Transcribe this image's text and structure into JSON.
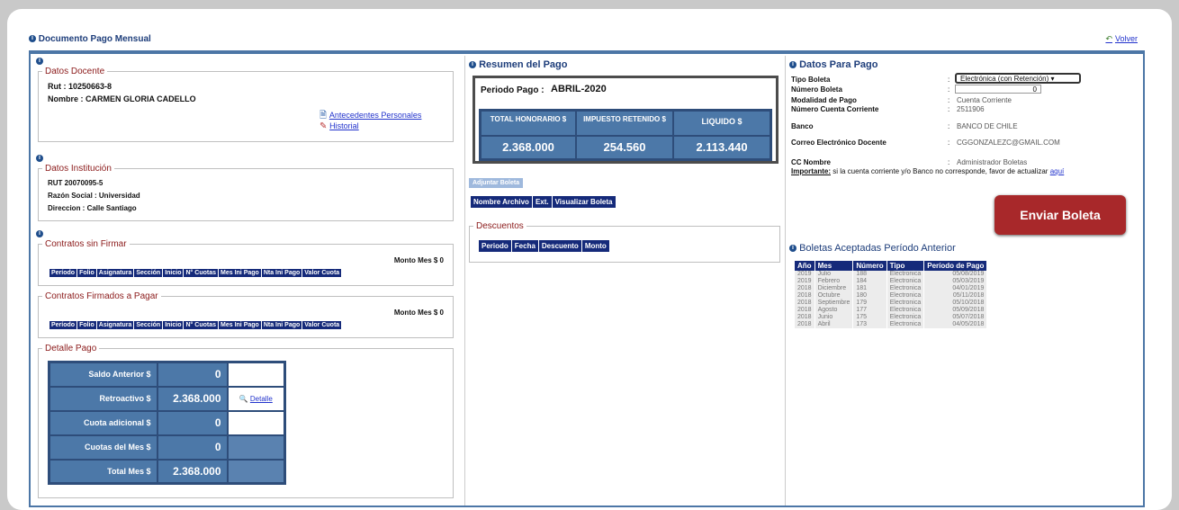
{
  "header": {
    "title": "Documento Pago Mensual",
    "back": "Volver"
  },
  "col1": {
    "docente": {
      "legend": "Datos Docente",
      "rut": "Rut : 10250663-8",
      "nombre": "Nombre : CARMEN GLORIA CADELLO",
      "link1": "Antecedentes Personales",
      "link2": "Historial"
    },
    "institucion": {
      "legend": "Datos Institución",
      "rut": "RUT 20070095-5",
      "razon": "Razón Social : Universidad",
      "direccion": "Direccion : Calle Santiago"
    },
    "sin_firmar": {
      "legend": "Contratos sin Firmar",
      "monto": "Monto Mes $ 0",
      "cols": [
        "Período",
        "Folio",
        "Asignatura",
        "Sección",
        "Inicio",
        "N° Cuotas",
        "Mes Ini Pago",
        "Nta Ini Pago",
        "Valor Cuota"
      ]
    },
    "firmados": {
      "legend": "Contratos Firmados a Pagar",
      "monto": "Monto Mes $ 0",
      "cols": [
        "Período",
        "Folio",
        "Asignatura",
        "Sección",
        "Inicio",
        "N° Cuotas",
        "Mes Ini Pago",
        "Nta Ini Pago",
        "Valor Cuota"
      ]
    },
    "detalle": {
      "legend": "Detalle Pago",
      "rows": [
        {
          "label": "Saldo Anterior $",
          "value": "0",
          "extra": ""
        },
        {
          "label": "Retroactivo $",
          "value": "2.368.000",
          "extra": "Detalle"
        },
        {
          "label": "Cuota adicional $",
          "value": "0",
          "extra": ""
        },
        {
          "label": "Cuotas del Mes $",
          "value": "0",
          "extra": ""
        },
        {
          "label": "Total Mes $",
          "value": "2.368.000",
          "extra": ""
        }
      ]
    }
  },
  "col2": {
    "title": "Resumen del Pago",
    "periodo_label": "Periodo Pago :",
    "periodo_value": "ABRIL-2020",
    "totals": [
      {
        "head": "TOTAL HONORARIO $",
        "value": "2.368.000"
      },
      {
        "head": "IMPUESTO RETENIDO $",
        "value": "254.560"
      },
      {
        "head": "LIQUIDO $",
        "value": "2.113.440"
      }
    ],
    "subir_btn": "Adjuntar Boleta",
    "archivo_cols": [
      "Nombre Archivo",
      "Ext.",
      "Visualizar Boleta"
    ],
    "descuentos": {
      "legend": "Descuentos",
      "cols": [
        "Periodo",
        "Fecha",
        "Descuento",
        "Monto"
      ]
    }
  },
  "col3": {
    "title": "Datos Para Pago",
    "fields": [
      {
        "label": "Tipo Boleta",
        "value": "Electrónica (con Retención)"
      },
      {
        "label": "Número Boleta",
        "value": "0"
      },
      {
        "label": "Modalidad de Pago",
        "value": "Cuenta Corriente"
      },
      {
        "label": "Número Cuenta Corriente",
        "value": "2511906"
      },
      {
        "label": "Banco",
        "value": "BANCO DE CHILE"
      },
      {
        "label": "Correo Electrónico Docente",
        "value": "CGGONZALEZC@GMAIL.COM"
      },
      {
        "label": "CC Nombre",
        "value": "Administrador Boletas"
      }
    ],
    "important_label": "Importante:",
    "important_text": " si la cuenta corriente y/o Banco no corresponde, favor de actualizar ",
    "important_link": "aquí",
    "send_btn": "Enviar Boleta",
    "accepted_title": "Boletas Aceptadas Período Anterior",
    "accepted_cols": [
      "Año",
      "Mes",
      "Número",
      "Tipo",
      "Período de Pago"
    ],
    "accepted_rows": [
      [
        "2019",
        "Julio",
        "188",
        "Electronica",
        "05/08/2019"
      ],
      [
        "2019",
        "Febrero",
        "184",
        "Electronica",
        "05/03/2019"
      ],
      [
        "2018",
        "Diciembre",
        "181",
        "Electronica",
        "04/01/2019"
      ],
      [
        "2018",
        "Octubre",
        "180",
        "Electronica",
        "05/11/2018"
      ],
      [
        "2018",
        "Septiembre",
        "179",
        "Electronica",
        "05/10/2018"
      ],
      [
        "2018",
        "Agosto",
        "177",
        "Electronica",
        "05/09/2018"
      ],
      [
        "2018",
        "Junio",
        "175",
        "Electronica",
        "05/07/2018"
      ],
      [
        "2018",
        "Abril",
        "173",
        "Electronica",
        "04/05/2018"
      ]
    ]
  },
  "colors": {
    "accent": "#4c78a8",
    "dark": "#152a7a",
    "send": "#a8282a"
  }
}
